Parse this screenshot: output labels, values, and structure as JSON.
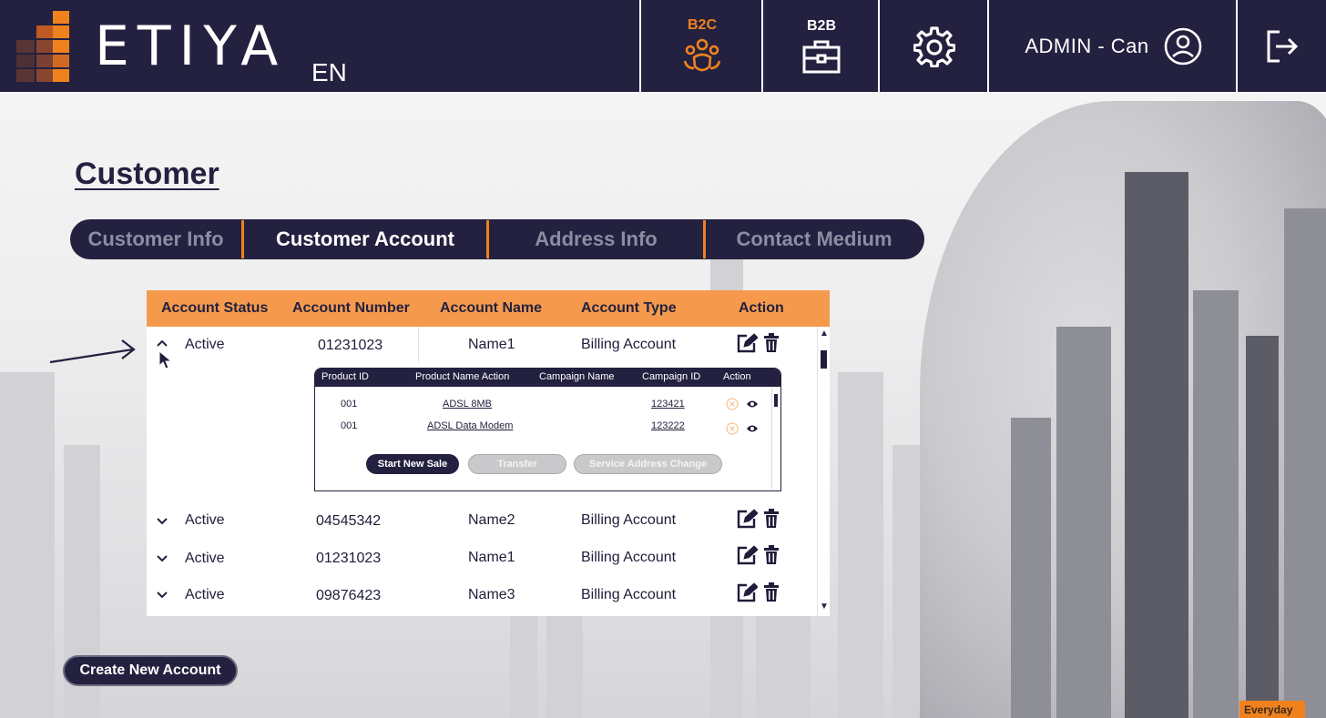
{
  "header": {
    "brand": "ETIYA",
    "language": "EN",
    "nav": {
      "b2c_label": "B2C",
      "b2b_label": "B2B"
    },
    "user_label": "ADMIN - Can",
    "active_color": "#f0821e",
    "bg_color": "#23213f"
  },
  "page": {
    "title": "Customer"
  },
  "tabs": [
    {
      "label": "Customer Info",
      "active": false
    },
    {
      "label": "Customer Account",
      "active": true
    },
    {
      "label": "Address Info",
      "active": false
    },
    {
      "label": "Contact Medium",
      "active": false
    }
  ],
  "table": {
    "headers": [
      "Account Status",
      "Account Number",
      "Account Name",
      "Account Type",
      "Action"
    ],
    "rows": [
      {
        "status": "Active",
        "number": "01231023",
        "name": "Name1",
        "type": "Billing Account",
        "expanded": true
      },
      {
        "status": "Active",
        "number": "04545342",
        "name": "Name2",
        "type": "Billing Account",
        "expanded": false
      },
      {
        "status": "Active",
        "number": "01231023",
        "name": "Name1",
        "type": "Billing Account",
        "expanded": false
      },
      {
        "status": "Active",
        "number": "09876423",
        "name": "Name3",
        "type": "Billing Account",
        "expanded": false
      }
    ]
  },
  "subtable": {
    "headers": [
      "Product ID",
      "Product Name Action",
      "Campaign Name",
      "Campaign ID",
      "Action"
    ],
    "rows": [
      {
        "product_id": "001",
        "product_name": "ADSL 8MB",
        "campaign_id": "123421"
      },
      {
        "product_id": "001",
        "product_name": "ADSL Data Modem",
        "campaign_id": "123222"
      }
    ],
    "buttons": {
      "start_new_sale": "Start New Sale",
      "transfer": "Transfer",
      "service_address_change": "Service Address Change"
    }
  },
  "create_account_label": "Create New Account",
  "badge_text": "Everyday",
  "icons": [
    "logo-mark-icon",
    "people-icon",
    "briefcase-icon",
    "gear-icon",
    "user-circle-icon",
    "logout-icon",
    "chevron-up-icon",
    "chevron-down-icon",
    "edit-icon",
    "trash-icon",
    "cancel-icon",
    "eye-icon",
    "arrow-icon",
    "cursor-icon"
  ]
}
